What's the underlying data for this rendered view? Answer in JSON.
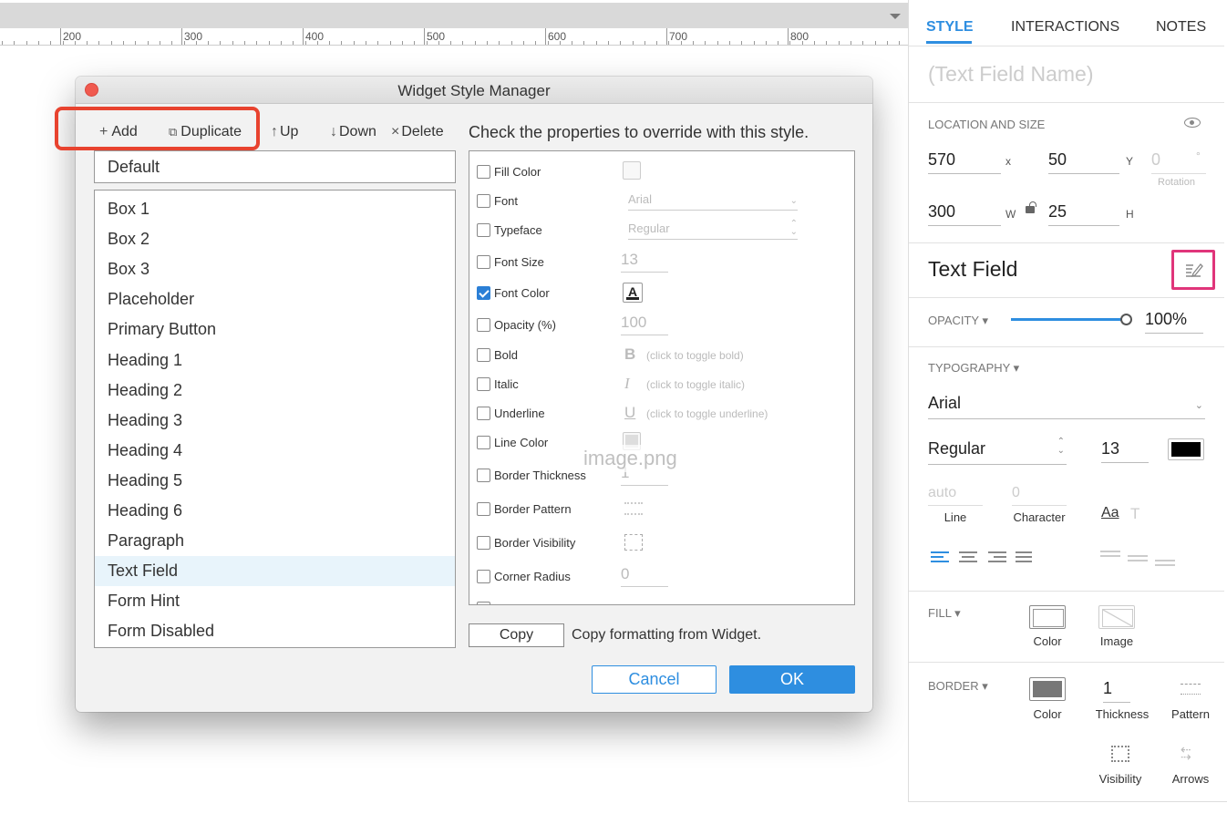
{
  "ruler": {
    "labels": [
      "200",
      "300",
      "400",
      "500",
      "600",
      "700",
      "800"
    ]
  },
  "dialog": {
    "title": "Widget Style Manager",
    "toolbar": {
      "add_icon": "+",
      "add_label": "Add",
      "duplicate_icon": "⧉",
      "duplicate_label": "Duplicate",
      "up_icon": "↑",
      "up_label": "Up",
      "down_icon": "↓",
      "down_label": "Down",
      "delete_icon": "×",
      "delete_label": "Delete"
    },
    "default_style": "Default",
    "styles": [
      "Box 1",
      "Box 2",
      "Box 3",
      "Placeholder",
      "Primary Button",
      "Heading 1",
      "Heading 2",
      "Heading 3",
      "Heading 4",
      "Heading 5",
      "Heading 6",
      "Paragraph",
      "Text Field",
      "Form Hint",
      "Form Disabled"
    ],
    "selected_style": "Text Field",
    "properties_title": "Check the properties to override with this style.",
    "properties": {
      "fill_color": {
        "label": "Fill Color",
        "checked": false
      },
      "font": {
        "label": "Font",
        "checked": false,
        "value": "Arial"
      },
      "typeface": {
        "label": "Typeface",
        "checked": false,
        "value": "Regular"
      },
      "font_size": {
        "label": "Font Size",
        "checked": false,
        "value": "13"
      },
      "font_color": {
        "label": "Font Color",
        "checked": true,
        "icon_letter": "A"
      },
      "opacity": {
        "label": "Opacity (%)",
        "checked": false,
        "value": "100"
      },
      "bold": {
        "label": "Bold",
        "checked": false,
        "glyph": "B",
        "hint": "(click to toggle bold)"
      },
      "italic": {
        "label": "Italic",
        "checked": false,
        "glyph": "I",
        "hint": "(click to toggle italic)"
      },
      "underline": {
        "label": "Underline",
        "checked": false,
        "glyph": "U",
        "hint": "(click to toggle underline)"
      },
      "line_color": {
        "label": "Line Color",
        "checked": false
      },
      "border_thickness": {
        "label": "Border Thickness",
        "checked": false,
        "value": "1"
      },
      "border_pattern": {
        "label": "Border Pattern",
        "checked": false
      },
      "border_visibility": {
        "label": "Border Visibility",
        "checked": false
      },
      "corner_radius": {
        "label": "Corner Radius",
        "checked": false,
        "value": "0"
      }
    },
    "watermark": "image.png",
    "copy_label": "Copy",
    "copy_desc": "Copy formatting from Widget.",
    "cancel_label": "Cancel",
    "ok_label": "OK"
  },
  "inspector": {
    "tabs": [
      "STYLE",
      "INTERACTIONS",
      "NOTES"
    ],
    "active_tab": "STYLE",
    "widget_name_placeholder": "(Text Field Name)",
    "location_size": {
      "label": "LOCATION AND SIZE",
      "x": "570",
      "x_unit": "x",
      "y": "50",
      "y_unit": "Y",
      "rotation": "0",
      "rotation_unit": "°",
      "rotation_label": "Rotation",
      "w": "300",
      "w_unit": "W",
      "h": "25",
      "h_unit": "H"
    },
    "style_name": "Text Field",
    "opacity": {
      "label": "OPACITY ▾",
      "value": "100%",
      "level": 1.0
    },
    "typography": {
      "label": "TYPOGRAPHY ▾",
      "font": "Arial",
      "typeface": "Regular",
      "size": "13",
      "color": "#000000",
      "line_value": "auto",
      "line_label": "Line",
      "char_value": "0",
      "char_label": "Character",
      "aa_label": "Aa",
      "t_label": "T"
    },
    "fill": {
      "label": "FILL ▾",
      "color_label": "Color",
      "image_label": "Image"
    },
    "border": {
      "label": "BORDER ▾",
      "color_label": "Color",
      "thickness_value": "1",
      "thickness_label": "Thickness",
      "pattern_label": "Pattern",
      "visibility_label": "Visibility",
      "arrows_label": "Arrows"
    }
  },
  "colors": {
    "accent": "#2e8ee0",
    "highlight_red": "#e8432f",
    "highlight_pink": "#e0357a",
    "close": "#f05a4f"
  }
}
